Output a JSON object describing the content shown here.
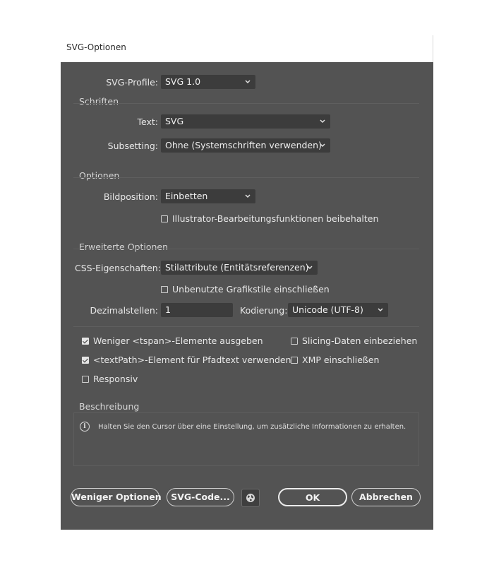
{
  "window": {
    "title": "SVG-Optionen"
  },
  "profile": {
    "label": "SVG-Profile:",
    "value": "SVG 1.0"
  },
  "fonts": {
    "section_title": "Schriften",
    "text_label": "Text:",
    "text_value": "SVG",
    "subsetting_label": "Subsetting:",
    "subsetting_value": "Ohne (Systemschriften verwenden)"
  },
  "options": {
    "section_title": "Optionen",
    "image_location_label": "Bildposition:",
    "image_location_value": "Einbetten",
    "preserve_label": "Illustrator-Bearbeitungsfunktionen beibehalten",
    "preserve_checked": false
  },
  "advanced": {
    "section_title": "Erweiterte Optionen",
    "css_label": "CSS-Eigenschaften:",
    "css_value": "Stilattribute (Entitätsreferenzen)",
    "unused_styles_label": "Unbenutzte Grafikstile einschließen",
    "unused_styles_checked": false,
    "decimals_label": "Dezimalstellen:",
    "decimals_value": "1",
    "encoding_label": "Kodierung:",
    "encoding_value": "Unicode (UTF-8)",
    "fewer_tspan_label": "Weniger <tspan>-Elemente ausgeben",
    "fewer_tspan_checked": true,
    "textpath_label": "<textPath>-Element für Pfadtext verwenden",
    "textpath_checked": true,
    "responsive_label": "Responsiv",
    "responsive_checked": false,
    "slicing_label": "Slicing-Daten einbeziehen",
    "slicing_checked": false,
    "xmp_label": "XMP einschließen",
    "xmp_checked": false
  },
  "description": {
    "section_title": "Beschreibung",
    "text": "Halten Sie den Cursor über eine Einstellung, um zusätzliche Informationen zu erhalten."
  },
  "buttons": {
    "fewer_options": "Weniger Optionen",
    "svg_code": "SVG-Code...",
    "ok": "OK",
    "cancel": "Abbrechen"
  },
  "icons": {
    "chevron": "chevron-down-icon",
    "info": "info-icon",
    "globe": "globe-icon"
  },
  "colors": {
    "dialog_bg": "#535353",
    "field_bg": "#3c3c3c",
    "text": "#e8e8e8"
  }
}
